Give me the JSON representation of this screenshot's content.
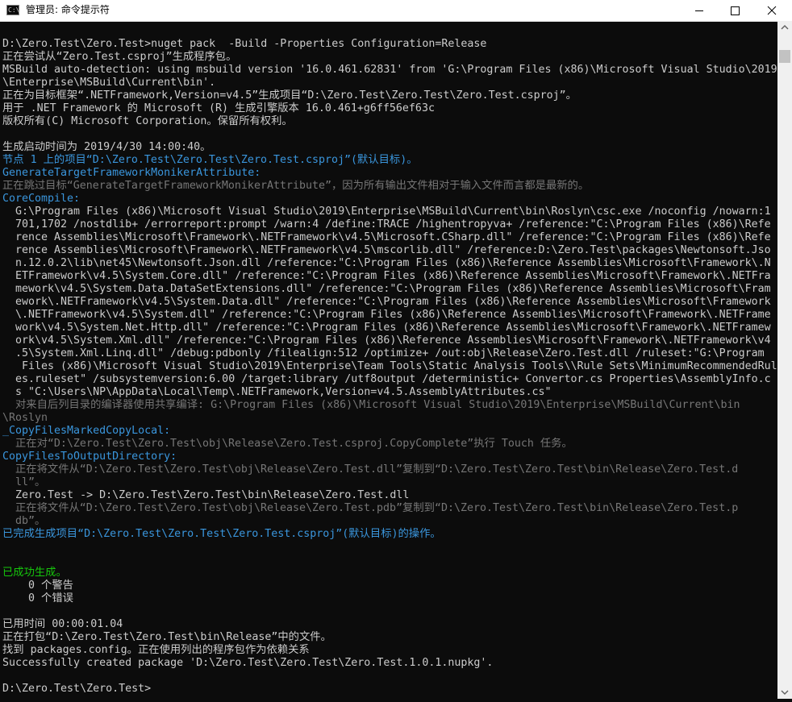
{
  "window": {
    "title": "管理员: 命令提示符",
    "icon_label": "C:\\"
  },
  "colors": {
    "default": "#cccccc",
    "cyan": "#3a96dd",
    "gray": "#767676",
    "green": "#16c60c"
  },
  "console_lines": [
    {
      "row": 1,
      "text": "D:\\Zero.Test\\Zero.Test>nuget pack  -Build -Properties Configuration=Release",
      "color": "default"
    },
    {
      "row": 2,
      "text": "正在尝试从“Zero.Test.csproj”生成程序包。",
      "color": "default"
    },
    {
      "row": 3,
      "text": "MSBuild auto-detection: using msbuild version '16.0.461.62831' from 'G:\\Program Files (x86)\\Microsoft Visual Studio\\2019",
      "color": "default"
    },
    {
      "row": 4,
      "text": "\\Enterprise\\MSBuild\\Current\\bin'.",
      "color": "default"
    },
    {
      "row": 5,
      "text": "正在为目标框架“.NETFramework,Version=v4.5”生成项目“D:\\Zero.Test\\Zero.Test\\Zero.Test.csproj”。",
      "color": "default"
    },
    {
      "row": 6,
      "text": "用于 .NET Framework 的 Microsoft (R) 生成引擎版本 16.0.461+g6ff56ef63c",
      "color": "default"
    },
    {
      "row": 7,
      "text": "版权所有(C) Microsoft Corporation。保留所有权利。",
      "color": "default"
    },
    {
      "row": 9,
      "text": "生成启动时间为 2019/4/30 14:00:40。",
      "color": "default"
    },
    {
      "row": 10,
      "text": "节点 1 上的项目“D:\\Zero.Test\\Zero.Test\\Zero.Test.csproj”(默认目标)。",
      "color": "cyan"
    },
    {
      "row": 11,
      "text": "GenerateTargetFrameworkMonikerAttribute:",
      "color": "cyan"
    },
    {
      "row": 12,
      "text": "正在跳过目标“GenerateTargetFrameworkMonikerAttribute”，因为所有输出文件相对于输入文件而言都是最新的。",
      "color": "gray"
    },
    {
      "row": 13,
      "text": "CoreCompile:",
      "color": "cyan"
    },
    {
      "row": 14,
      "text": "  G:\\Program Files (x86)\\Microsoft Visual Studio\\2019\\Enterprise\\MSBuild\\Current\\bin\\Roslyn\\csc.exe /noconfig /nowarn:1",
      "color": "default"
    },
    {
      "row": 15,
      "text": "  701,1702 /nostdlib+ /errorreport:prompt /warn:4 /define:TRACE /highentropyva+ /reference:\"C:\\Program Files (x86)\\Refe",
      "color": "default"
    },
    {
      "row": 16,
      "text": "  rence Assemblies\\Microsoft\\Framework\\.NETFramework\\v4.5\\Microsoft.CSharp.dll\" /reference:\"C:\\Program Files (x86)\\Refe",
      "color": "default"
    },
    {
      "row": 17,
      "text": "  rence Assemblies\\Microsoft\\Framework\\.NETFramework\\v4.5\\mscorlib.dll\" /reference:D:\\Zero.Test\\packages\\Newtonsoft.Jso",
      "color": "default"
    },
    {
      "row": 18,
      "text": "  n.12.0.2\\lib\\net45\\Newtonsoft.Json.dll /reference:\"C:\\Program Files (x86)\\Reference Assemblies\\Microsoft\\Framework\\.N",
      "color": "default"
    },
    {
      "row": 19,
      "text": "  ETFramework\\v4.5\\System.Core.dll\" /reference:\"C:\\Program Files (x86)\\Reference Assemblies\\Microsoft\\Framework\\.NETFra",
      "color": "default"
    },
    {
      "row": 20,
      "text": "  mework\\v4.5\\System.Data.DataSetExtensions.dll\" /reference:\"C:\\Program Files (x86)\\Reference Assemblies\\Microsoft\\Fram",
      "color": "default"
    },
    {
      "row": 21,
      "text": "  ework\\.NETFramework\\v4.5\\System.Data.dll\" /reference:\"C:\\Program Files (x86)\\Reference Assemblies\\Microsoft\\Framework",
      "color": "default"
    },
    {
      "row": 22,
      "text": "  \\.NETFramework\\v4.5\\System.dll\" /reference:\"C:\\Program Files (x86)\\Reference Assemblies\\Microsoft\\Framework\\.NETFrame",
      "color": "default"
    },
    {
      "row": 23,
      "text": "  work\\v4.5\\System.Net.Http.dll\" /reference:\"C:\\Program Files (x86)\\Reference Assemblies\\Microsoft\\Framework\\.NETFramew",
      "color": "default"
    },
    {
      "row": 24,
      "text": "  ork\\v4.5\\System.Xml.dll\" /reference:\"C:\\Program Files (x86)\\Reference Assemblies\\Microsoft\\Framework\\.NETFramework\\v4",
      "color": "default"
    },
    {
      "row": 25,
      "text": "  .5\\System.Xml.Linq.dll\" /debug:pdbonly /filealign:512 /optimize+ /out:obj\\Release\\Zero.Test.dll /ruleset:\"G:\\Program",
      "color": "default"
    },
    {
      "row": 26,
      "text": "   Files (x86)\\Microsoft Visual Studio\\2019\\Enterprise\\Team Tools\\Static Analysis Tools\\\\Rule Sets\\MinimumRecommendedRul",
      "color": "default"
    },
    {
      "row": 27,
      "text": "  es.ruleset\" /subsystemversion:6.00 /target:library /utf8output /deterministic+ Convertor.cs Properties\\AssemblyInfo.c",
      "color": "default"
    },
    {
      "row": 28,
      "text": "  s \"C:\\Users\\NP\\AppData\\Local\\Temp\\.NETFramework,Version=v4.5.AssemblyAttributes.cs\"",
      "color": "default"
    },
    {
      "row": 29,
      "text": "  对来自后列目录的编译器使用共享编译: G:\\Program Files (x86)\\Microsoft Visual Studio\\2019\\Enterprise\\MSBuild\\Current\\bin",
      "color": "gray"
    },
    {
      "row": 30,
      "text": "\\Roslyn",
      "color": "gray"
    },
    {
      "row": 31,
      "text": "_CopyFilesMarkedCopyLocal:",
      "color": "cyan"
    },
    {
      "row": 32,
      "text": "  正在对“D:\\Zero.Test\\Zero.Test\\obj\\Release\\Zero.Test.csproj.CopyComplete”执行 Touch 任务。",
      "color": "gray"
    },
    {
      "row": 33,
      "text": "CopyFilesToOutputDirectory:",
      "color": "cyan"
    },
    {
      "row": 34,
      "text": "  正在将文件从“D:\\Zero.Test\\Zero.Test\\obj\\Release\\Zero.Test.dll”复制到“D:\\Zero.Test\\Zero.Test\\bin\\Release\\Zero.Test.d",
      "color": "gray"
    },
    {
      "row": 35,
      "text": "  ll”。",
      "color": "gray"
    },
    {
      "row": 36,
      "text": "  Zero.Test -> D:\\Zero.Test\\Zero.Test\\bin\\Release\\Zero.Test.dll",
      "color": "default"
    },
    {
      "row": 37,
      "text": "  正在将文件从“D:\\Zero.Test\\Zero.Test\\obj\\Release\\Zero.Test.pdb”复制到“D:\\Zero.Test\\Zero.Test\\bin\\Release\\Zero.Test.p",
      "color": "gray"
    },
    {
      "row": 38,
      "text": "  db”。",
      "color": "gray"
    },
    {
      "row": 39,
      "text": "已完成生成项目“D:\\Zero.Test\\Zero.Test\\Zero.Test.csproj”(默认目标)的操作。",
      "color": "cyan"
    },
    {
      "row": 42,
      "text": "已成功生成。",
      "color": "green"
    },
    {
      "row": 43,
      "text": "    0 个警告",
      "color": "default"
    },
    {
      "row": 44,
      "text": "    0 个错误",
      "color": "default"
    },
    {
      "row": 46,
      "text": "已用时间 00:00:01.04",
      "color": "default"
    },
    {
      "row": 47,
      "text": "正在打包“D:\\Zero.Test\\Zero.Test\\bin\\Release”中的文件。",
      "color": "default"
    },
    {
      "row": 48,
      "text": "找到 packages.config。正在使用列出的程序包作为依赖关系",
      "color": "default"
    },
    {
      "row": 49,
      "text": "Successfully created package 'D:\\Zero.Test\\Zero.Test\\Zero.Test.1.0.1.nupkg'.",
      "color": "default"
    },
    {
      "row": 51,
      "text": "D:\\Zero.Test\\Zero.Test>",
      "color": "default"
    }
  ]
}
